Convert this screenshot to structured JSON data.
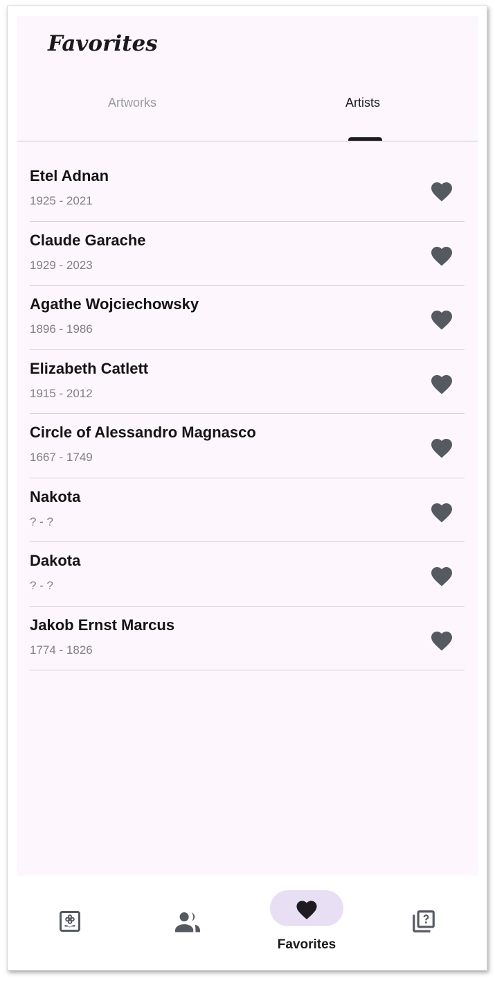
{
  "header": {
    "title": "Favorites"
  },
  "tabs": [
    {
      "label": "Artworks",
      "selected": false
    },
    {
      "label": "Artists",
      "selected": true
    }
  ],
  "artists": [
    {
      "name": "Etel Adnan",
      "dates": "1925 - 2021"
    },
    {
      "name": "Claude Garache",
      "dates": "1929 - 2023"
    },
    {
      "name": "Agathe Wojciechowsky",
      "dates": "1896 - 1986"
    },
    {
      "name": "Elizabeth Catlett",
      "dates": "1915 - 2012"
    },
    {
      "name": "Circle of Alessandro Magnasco",
      "dates": "1667 - 1749"
    },
    {
      "name": "Nakota",
      "dates": "? - ?"
    },
    {
      "name": "Dakota",
      "dates": "? - ?"
    },
    {
      "name": "Jakob Ernst Marcus",
      "dates": "1774 - 1826"
    }
  ],
  "bottom_nav": {
    "items": [
      {
        "icon": "artwork-frame-icon",
        "label": ""
      },
      {
        "icon": "people-icon",
        "label": ""
      },
      {
        "icon": "heart-icon",
        "label": "Favorites",
        "selected": true
      },
      {
        "icon": "quiz-icon",
        "label": ""
      }
    ]
  },
  "colors": {
    "background": "#fdf6fc",
    "heart": "#555a61",
    "selected_pill": "#e8dff5",
    "text": "#141414",
    "secondary_text": "#808080"
  }
}
